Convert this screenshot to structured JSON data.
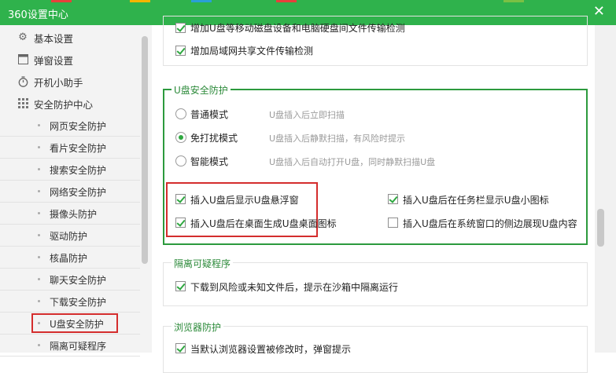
{
  "window": {
    "title": "360设置中心",
    "close_glyph": "✕"
  },
  "sidebar": {
    "top_items": [
      {
        "label": "基本设置",
        "icon": "gear-icon"
      },
      {
        "label": "弹窗设置",
        "icon": "window-icon"
      },
      {
        "label": "开机小助手",
        "icon": "stopwatch-icon"
      },
      {
        "label": "安全防护中心",
        "icon": "grid-icon"
      }
    ],
    "sub_items": [
      {
        "label": "网页安全防护"
      },
      {
        "label": "看片安全防护"
      },
      {
        "label": "搜索安全防护"
      },
      {
        "label": "网络安全防护"
      },
      {
        "label": "摄像头防护"
      },
      {
        "label": "驱动防护"
      },
      {
        "label": "核晶防护"
      },
      {
        "label": "聊天安全防护"
      },
      {
        "label": "下载安全防护"
      },
      {
        "label": "U盘安全防护"
      },
      {
        "label": "隔离可疑程序"
      }
    ],
    "active": "U盘安全防护"
  },
  "main": {
    "top_options": [
      {
        "label": "增加U盘等移动磁盘设备和电脑硬盘间文件传输检测",
        "checked": true
      },
      {
        "label": "增加局域网共享文件传输检测",
        "checked": true
      }
    ],
    "usb": {
      "title": "U盘安全防护",
      "modes": [
        {
          "label": "普通模式",
          "desc": "U盘插入后立即扫描",
          "selected": false
        },
        {
          "label": "免打扰模式",
          "desc": "U盘插入后静默扫描，有风险时提示",
          "selected": true
        },
        {
          "label": "智能模式",
          "desc": "U盘插入后自动打开U盘，同时静默扫描U盘",
          "selected": false
        }
      ],
      "options": [
        {
          "label": "插入U盘后显示U盘悬浮窗",
          "checked": true
        },
        {
          "label": "插入U盘后在任务栏显示U盘小图标",
          "checked": true
        },
        {
          "label": "插入U盘后在桌面生成U盘桌面图标",
          "checked": true
        },
        {
          "label": "插入U盘后在系统窗口的侧边展现U盘内容",
          "checked": false
        }
      ]
    },
    "isolate": {
      "title": "隔离可疑程序",
      "options": [
        {
          "label": "下载到风险或未知文件后，提示在沙箱中隔离运行",
          "checked": true
        }
      ]
    },
    "browser": {
      "title": "浏览器防护",
      "options": [
        {
          "label": "当默认浏览器设置被修改时，弹窗提示",
          "checked": true
        }
      ]
    }
  },
  "colors": {
    "titlebar": "#2fb24c",
    "accent_green": "#2fa840",
    "highlight_red": "#d42d2d",
    "sidebar_bg": "#f3f3f3"
  }
}
